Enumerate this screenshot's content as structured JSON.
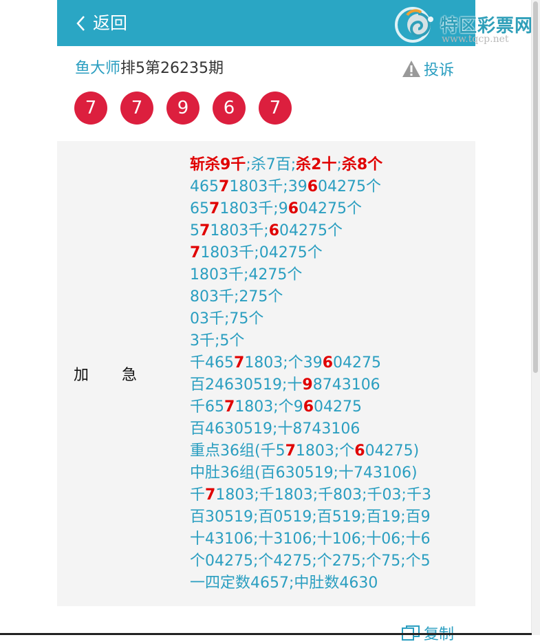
{
  "header": {
    "back_label": "返回"
  },
  "logo": {
    "title": "特区彩票网",
    "url": "www.tqcp.net"
  },
  "title_row": {
    "master": "鱼大师",
    "issue": "排5第26235期"
  },
  "complain_label": "投诉",
  "balls": [
    "7",
    "7",
    "9",
    "6",
    "7"
  ],
  "category": "加急",
  "lines": [
    [
      [
        "斩杀9千",
        1
      ],
      [
        ";杀7百;",
        0
      ],
      [
        "杀2十",
        1
      ],
      [
        ";",
        0
      ],
      [
        "杀8个",
        1
      ]
    ],
    [
      [
        "465",
        0
      ],
      [
        "7",
        1
      ],
      [
        "1803千;39",
        0
      ],
      [
        "6",
        1
      ],
      [
        "04275个",
        0
      ]
    ],
    [
      [
        "65",
        0
      ],
      [
        "7",
        1
      ],
      [
        "1803千;9",
        0
      ],
      [
        "6",
        1
      ],
      [
        "04275个",
        0
      ]
    ],
    [
      [
        "5",
        0
      ],
      [
        "7",
        1
      ],
      [
        "1803千;",
        0
      ],
      [
        "6",
        1
      ],
      [
        "04275个",
        0
      ]
    ],
    [
      [
        "7",
        1
      ],
      [
        "1803千;04275个",
        0
      ]
    ],
    [
      [
        "1803千;4275个",
        0
      ]
    ],
    [
      [
        "803千;275个",
        0
      ]
    ],
    [
      [
        "03千;75个",
        0
      ]
    ],
    [
      [
        "3千;5个",
        0
      ]
    ],
    [
      [
        "千465",
        0
      ],
      [
        "7",
        1
      ],
      [
        "1803;个39",
        0
      ],
      [
        "6",
        1
      ],
      [
        "04275",
        0
      ]
    ],
    [
      [
        "百24630519;十",
        0
      ],
      [
        "9",
        1
      ],
      [
        "8743106",
        0
      ]
    ],
    [
      [
        "千65",
        0
      ],
      [
        "7",
        1
      ],
      [
        "1803;个9",
        0
      ],
      [
        "6",
        1
      ],
      [
        "04275",
        0
      ]
    ],
    [
      [
        "百4630519;十8743106",
        0
      ]
    ],
    [
      [
        "重点36组(千5",
        0
      ],
      [
        "7",
        1
      ],
      [
        "1803;个",
        0
      ],
      [
        "6",
        1
      ],
      [
        "04275)",
        0
      ]
    ],
    [
      [
        "中肚36组(百630519;十743106)",
        0
      ]
    ],
    [
      [
        "千",
        0
      ],
      [
        "7",
        1
      ],
      [
        "1803;千1803;千803;千03;千3",
        0
      ]
    ],
    [
      [
        "百30519;百0519;百519;百19;百9",
        0
      ]
    ],
    [
      [
        "十43106;十3106;十106;十06;十6",
        0
      ]
    ],
    [
      [
        "个04275;个4275;个275;个75;个5",
        0
      ]
    ],
    [
      [
        "一四定数4657;中肚数4630",
        0
      ]
    ]
  ],
  "copy_label": "复制",
  "colors": {
    "header": "#2aa6c4",
    "ball": "#dc1f3e",
    "link": "#2a9ec0",
    "highlight": "#e00000"
  }
}
